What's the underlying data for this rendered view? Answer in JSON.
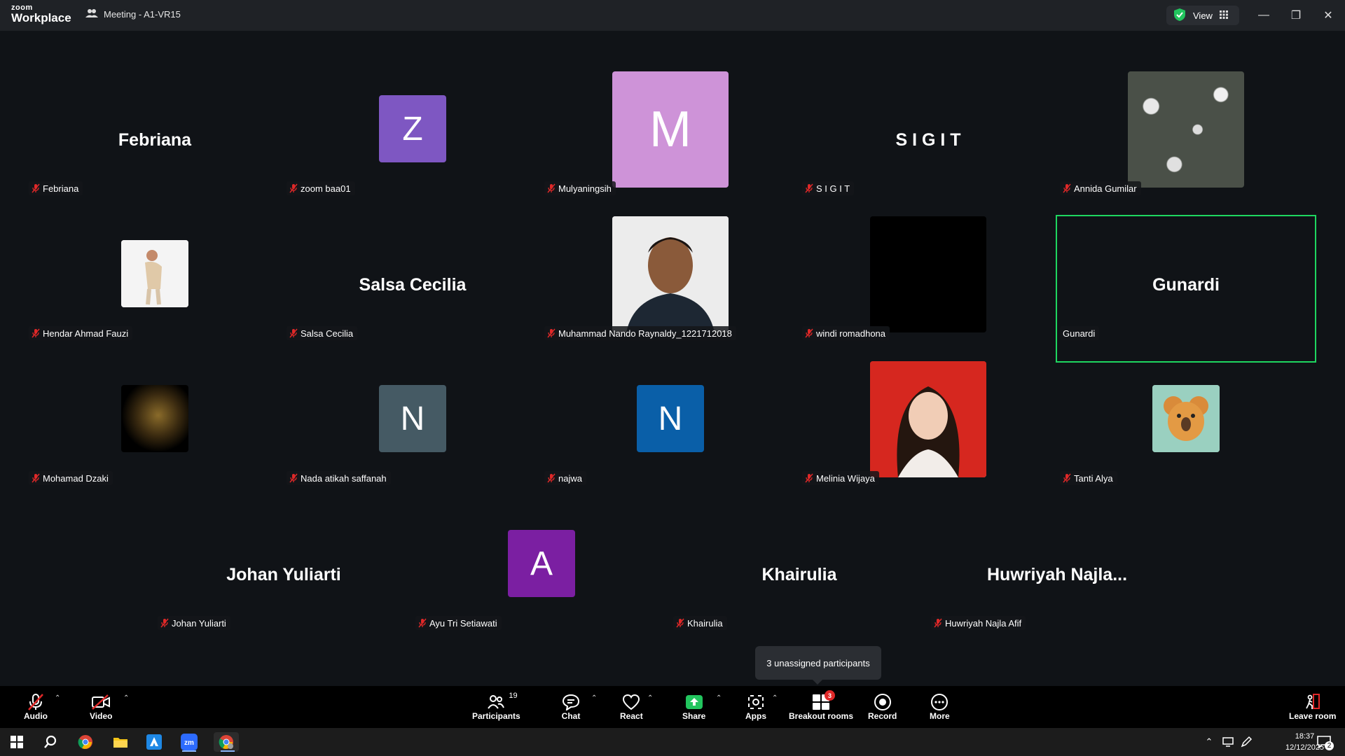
{
  "app": {
    "logo_line1": "zoom",
    "logo_line2": "Workplace",
    "meeting_title": "Meeting - A1-VR15",
    "view_label": "View",
    "colors": {
      "background": "#101317",
      "titlebar": "#1f2226",
      "active_border": "#1ed760",
      "share_green": "#22c55e",
      "badge_red": "#e02828"
    }
  },
  "participants": [
    {
      "name": "Febriana",
      "display": "Febriana",
      "type": "text"
    },
    {
      "name": "zoom baa01",
      "display": "Z",
      "type": "initial",
      "color": "#7e57c2"
    },
    {
      "name": "Mulyaningsih",
      "display": "M",
      "type": "initial-large",
      "color": "#ce93d8"
    },
    {
      "name": "S I G I T",
      "display": "S I G I T",
      "type": "text"
    },
    {
      "name": "Annida Gumilar",
      "display": "",
      "type": "photo-flowers"
    },
    {
      "name": "Hendar Ahmad Fauzi",
      "display": "",
      "type": "photo-person-white"
    },
    {
      "name": "Salsa Cecilia",
      "display": "Salsa Cecilia",
      "type": "text"
    },
    {
      "name": "Muhammad Nando Raynaldy_1221712018",
      "display": "",
      "type": "photo-man"
    },
    {
      "name": "windi romadhona",
      "display": "",
      "type": "photo-dark"
    },
    {
      "name": "Gunardi",
      "display": "Gunardi",
      "type": "text",
      "active": true
    },
    {
      "name": "Mohamad Dzaki",
      "display": "",
      "type": "photo-buddha"
    },
    {
      "name": "Nada atikah saffanah",
      "display": "N",
      "type": "initial",
      "color": "#455a64"
    },
    {
      "name": "najwa",
      "display": "N",
      "type": "initial",
      "color": "#0a5fa8"
    },
    {
      "name": "Melinia Wijaya",
      "display": "",
      "type": "photo-woman"
    },
    {
      "name": "Tanti Alya",
      "display": "",
      "type": "photo-koala"
    },
    {
      "name": "Johan Yuliarti",
      "display": "Johan Yuliarti",
      "type": "text"
    },
    {
      "name": "Ayu Tri Setiawati",
      "display": "A",
      "type": "initial",
      "color": "#7b1fa2"
    },
    {
      "name": "Khairulia",
      "display": "Khairulia",
      "type": "text"
    },
    {
      "name": "Huwriyah Najla Afif",
      "display": "Huwriyah  Najla...",
      "type": "text"
    }
  ],
  "tooltip": {
    "text": "3 unassigned participants"
  },
  "toolbar": {
    "audio": "Audio",
    "video": "Video",
    "participants": "Participants",
    "participants_count": "19",
    "chat": "Chat",
    "react": "React",
    "share": "Share",
    "apps": "Apps",
    "breakout": "Breakout rooms",
    "breakout_badge": "3",
    "record": "Record",
    "more": "More",
    "leave": "Leave room"
  },
  "taskbar": {
    "time": "18:37",
    "date": "12/12/2025",
    "notifications": "2",
    "icons": [
      "windows-start-icon",
      "search-icon",
      "chrome-icon",
      "file-explorer-icon",
      "azure-data-studio-icon",
      "zoom-icon",
      "chrome-profile-icon"
    ]
  }
}
